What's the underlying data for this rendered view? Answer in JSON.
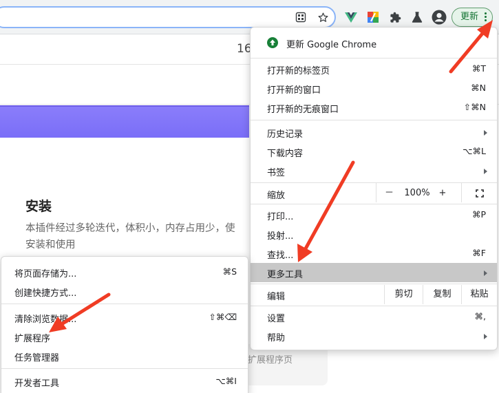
{
  "toolbar": {
    "update_label": "更新",
    "icons": [
      "apps-grid-icon",
      "star-icon",
      "vue-devtools-icon",
      "color-picker-icon",
      "puzzle-extensions-icon",
      "labs-flask-icon",
      "profile-avatar-icon",
      "kebab-menu-icon"
    ]
  },
  "page": {
    "partial_number": "16",
    "install_heading": "安装",
    "install_desc_line1": "本插件经过多轮迭代，体积小，内存占用少，使",
    "install_desc_line2": "安装和使用",
    "behind_text": "扩展程序页"
  },
  "chrome_menu": {
    "update_item": "更新 Google Chrome",
    "new_tab": {
      "label": "打开新的标签页",
      "shortcut": "⌘T"
    },
    "new_window": {
      "label": "打开新的窗口",
      "shortcut": "⌘N"
    },
    "incognito": {
      "label": "打开新的无痕窗口",
      "shortcut": "⇧⌘N"
    },
    "history": {
      "label": "历史记录"
    },
    "downloads": {
      "label": "下载内容",
      "shortcut": "⌥⌘L"
    },
    "bookmarks": {
      "label": "书签"
    },
    "zoom": {
      "label": "缩放",
      "minus": "－",
      "value": "100%",
      "plus": "+"
    },
    "print": {
      "label": "打印...",
      "shortcut": "⌘P"
    },
    "cast": {
      "label": "投射..."
    },
    "find": {
      "label": "查找...",
      "shortcut": "⌘F"
    },
    "more_tools": {
      "label": "更多工具"
    },
    "edit": {
      "label": "编辑",
      "cut": "剪切",
      "copy": "复制",
      "paste": "粘贴"
    },
    "settings": {
      "label": "设置",
      "shortcut": "⌘,"
    },
    "help": {
      "label": "帮助"
    }
  },
  "more_tools_menu": {
    "save_page": {
      "label": "将页面存储为...",
      "shortcut": "⌘S"
    },
    "create_shortcut": {
      "label": "创建快捷方式..."
    },
    "clear_data": {
      "label": "清除浏览数据...",
      "shortcut": "⇧⌘⌫"
    },
    "extensions": {
      "label": "扩展程序"
    },
    "task_manager": {
      "label": "任务管理器"
    },
    "dev_tools": {
      "label": "开发者工具",
      "shortcut": "⌥⌘I"
    }
  },
  "colors": {
    "highlight": "#c8c8c8",
    "hero_band": "#7a6ef8",
    "update_green": "#188038",
    "annotation_red": "#f03c24"
  }
}
